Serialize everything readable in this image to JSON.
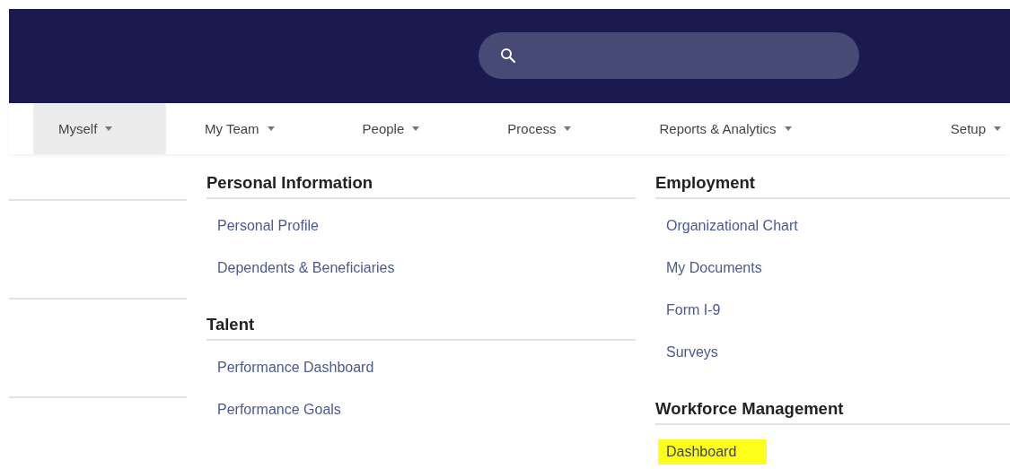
{
  "nav_tabs": [
    {
      "label": "Myself",
      "selected": true
    },
    {
      "label": "My Team",
      "selected": false
    },
    {
      "label": "People",
      "selected": false
    },
    {
      "label": "Process",
      "selected": false
    },
    {
      "label": "Reports & Analytics",
      "selected": false
    },
    {
      "label": "Setup",
      "selected": false
    }
  ],
  "menu_columns": [
    {
      "sections": [
        {
          "heading": "Personal Information",
          "items": [
            {
              "label": "Personal Profile",
              "highlighted": false
            },
            {
              "label": "Dependents & Beneficiaries",
              "highlighted": false
            }
          ]
        },
        {
          "heading": "Talent",
          "items": [
            {
              "label": "Performance Dashboard",
              "highlighted": false
            },
            {
              "label": "Performance Goals",
              "highlighted": false
            }
          ]
        }
      ]
    },
    {
      "sections": [
        {
          "heading": "Employment",
          "items": [
            {
              "label": "Organizational Chart",
              "highlighted": false
            },
            {
              "label": "My Documents",
              "highlighted": false
            },
            {
              "label": "Form I-9",
              "highlighted": false
            },
            {
              "label": "Surveys",
              "highlighted": false
            }
          ]
        },
        {
          "heading": "Workforce Management",
          "items": [
            {
              "label": "Dashboard",
              "highlighted": true
            }
          ]
        }
      ]
    }
  ]
}
